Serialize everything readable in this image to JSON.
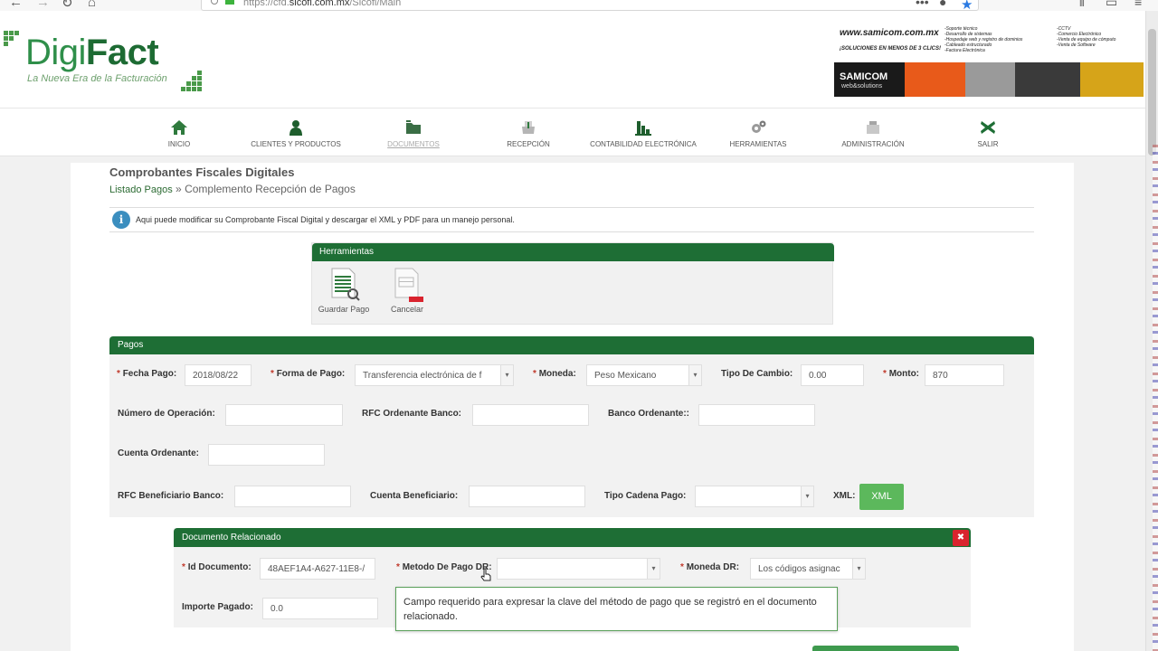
{
  "browser": {
    "url_prefix": "https://cfd.",
    "url_domain": "sicofi.com.mx",
    "url_path": "/Sicofi/Main"
  },
  "logo": {
    "name_part1": "Digi",
    "name_part2": "Fact",
    "tagline": "La Nueva Era de la Facturación"
  },
  "banner": {
    "url": "www.samicom.com.mx",
    "slogan": "¡SOLUCIONES EN MENOS DE 3 CLICS!",
    "services_left": [
      "-Soporte técnico",
      "-Desarrollo de sistemas",
      "-Hospedaje web y registro de dominios",
      "-Cableado estructurado",
      "-Factura Electrónica"
    ],
    "services_right": [
      "-CCTV",
      "-Comercio Electrónico",
      "-Venta de equipo de cómputo",
      "-Venta de Software"
    ],
    "brand": "SAMICOM",
    "brand_sub": "web&solutions"
  },
  "menu": [
    {
      "label": "INICIO"
    },
    {
      "label": "CLIENTES Y PRODUCTOS"
    },
    {
      "label": "DOCUMENTOS"
    },
    {
      "label": "RECEPCIÓN"
    },
    {
      "label": "CONTABILIDAD ELECTRÓNICA"
    },
    {
      "label": "HERRAMIENTAS"
    },
    {
      "label": "ADMINISTRACIÓN"
    },
    {
      "label": "SALIR"
    }
  ],
  "page": {
    "title": "Comprobantes Fiscales Digitales",
    "breadcrumb_link": "Listado Pagos",
    "breadcrumb_sep": " » ",
    "breadcrumb_current": "Complemento Recepción de Pagos",
    "info_text": "Aqui puede modificar su Comprobante Fiscal Digital y descargar el XML y PDF para un manejo personal."
  },
  "tools": {
    "title": "Herramientas",
    "save_label": "Guardar Pago",
    "cancel_label": "Cancelar"
  },
  "pagos": {
    "title": "Pagos",
    "fecha_label": "Fecha Pago:",
    "fecha_value": "2018/08/22",
    "forma_label": "Forma de Pago:",
    "forma_value": "Transferencia electrónica de f",
    "moneda_label": "Moneda:",
    "moneda_value": "Peso Mexicano",
    "tipo_cambio_label": "Tipo De Cambio:",
    "tipo_cambio_value": "0.00",
    "monto_label": "Monto:",
    "monto_value": "870",
    "num_operacion_label": "Número de Operación:",
    "rfc_ordenante_label": "RFC Ordenante Banco:",
    "banco_ordenante_label": "Banco Ordenante::",
    "cuenta_ordenante_label": "Cuenta Ordenante:",
    "rfc_beneficiario_label": "RFC Beneficiario Banco:",
    "cuenta_beneficiario_label": "Cuenta Beneficiario:",
    "tipo_cadena_label": "Tipo Cadena Pago:",
    "xml_label": "XML:",
    "xml_button": "XML"
  },
  "docrel": {
    "title": "Documento Relacionado",
    "close_symbol": "✖",
    "id_label": "Id Documento:",
    "id_value": "48AEF1A4-A627-11E8-/",
    "metodo_label": "Metodo De Pago DR:",
    "moneda_label": "Moneda DR:",
    "moneda_value": "Los códigos asignac",
    "importe_label": "Importe Pagado:",
    "importe_value": "0.0",
    "required_mark": "*"
  },
  "tooltip": {
    "text": "Campo requerido para expresar la clave del método de pago que se registró en el documento relacionado."
  },
  "colors": {
    "primary_green": "#1e6e35",
    "button_green": "#5cb85c",
    "required_red": "#c0392b",
    "close_red": "#d9232e",
    "info_blue": "#3b8ebf"
  }
}
